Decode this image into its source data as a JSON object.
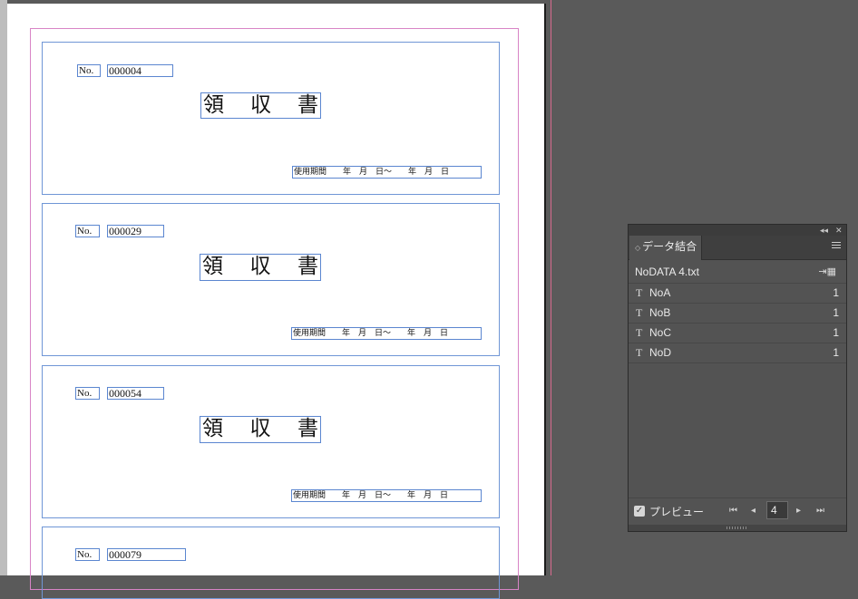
{
  "document": {
    "receipts": [
      {
        "no_label": "No.",
        "number": "000004",
        "title_chars": [
          "領",
          "収",
          "書"
        ],
        "period": "使用期間　　年　月　日～　　年　月　日"
      },
      {
        "no_label": "No.",
        "number": "000029",
        "title_chars": [
          "領",
          "収",
          "書"
        ],
        "period": "使用期間　　年　月　日～　　年　月　日"
      },
      {
        "no_label": "No.",
        "number": "000054",
        "title_chars": [
          "領",
          "収",
          "書"
        ],
        "period": "使用期間　　年　月　日～　　年　月　日"
      },
      {
        "no_label": "No.",
        "number": "000079"
      }
    ]
  },
  "panel": {
    "tab_label": "データ結合",
    "data_source": "NoDATA 4.txt",
    "fields": [
      {
        "type_icon": "T",
        "name": "NoA",
        "value": "1"
      },
      {
        "type_icon": "T",
        "name": "NoB",
        "value": "1"
      },
      {
        "type_icon": "T",
        "name": "NoC",
        "value": "1"
      },
      {
        "type_icon": "T",
        "name": "NoD",
        "value": "1"
      }
    ],
    "preview_label": "プレビュー",
    "preview_checked": true,
    "current_record": "4",
    "icons": {
      "collapse": "double-chevron-left-icon",
      "close": "close-icon",
      "menu": "hamburger-menu-icon",
      "link": "link-source-icon",
      "first": "first-record-icon",
      "prev": "previous-record-icon",
      "next": "next-record-icon",
      "last": "last-record-icon"
    }
  },
  "colors": {
    "workspace_bg": "#5a5a5a",
    "frame_border": "#5b86d0",
    "margin_guide": "#d884c6",
    "bleed_guide": "#d96b8f",
    "panel_bg": "#535353"
  }
}
